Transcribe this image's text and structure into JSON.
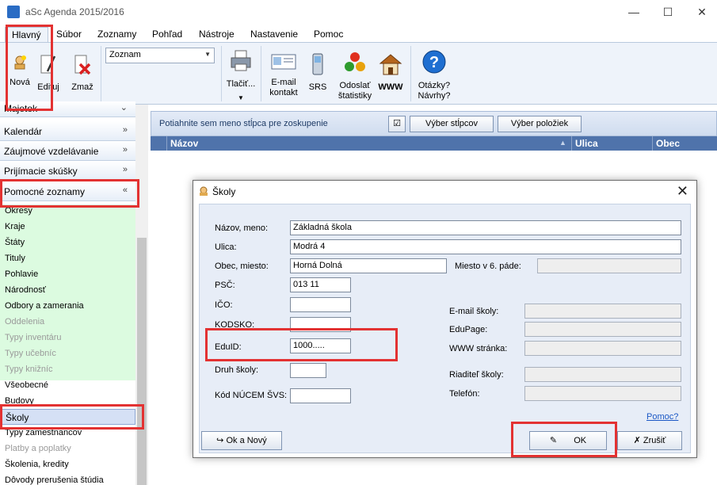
{
  "window": {
    "title": "aSc Agenda 2015/2016",
    "controls": {
      "minimize": "—",
      "maximize": "☐",
      "close": "✕"
    }
  },
  "ribbon_tabs": [
    "Hlavný",
    "Súbor",
    "Zoznamy",
    "Pohľad",
    "Nástroje",
    "Nastavenie",
    "Pomoc"
  ],
  "ribbon": {
    "nova": "Nová",
    "edituj": "Edituj",
    "zmaz": "Zmaž",
    "combo_value": "Zoznam",
    "tlacit": "Tlačiť...",
    "email_kontakt": [
      "E-mail",
      "kontakt"
    ],
    "srs": "SRS",
    "odoslat": [
      "Odoslať",
      "štatistiky"
    ],
    "www": "WWW",
    "otazky": [
      "Otázky?",
      "Návrhy?"
    ]
  },
  "sidebar": {
    "top_partial": "Majetok",
    "sections": [
      "Kalendár",
      "Záujmové vzdelávanie",
      "Prijímacie skúšky",
      "Pomocné zoznamy"
    ],
    "items": [
      {
        "label": "Okresy",
        "disabled": false
      },
      {
        "label": "Kraje",
        "disabled": false
      },
      {
        "label": "Štáty",
        "disabled": false
      },
      {
        "label": "Tituly",
        "disabled": false
      },
      {
        "label": "Pohlavie",
        "disabled": false
      },
      {
        "label": "Národnosť",
        "disabled": false
      },
      {
        "label": "Odbory a zamerania",
        "disabled": false
      },
      {
        "label": "Oddelenia",
        "disabled": true
      },
      {
        "label": "Typy inventáru",
        "disabled": true
      },
      {
        "label": "Typy učebníc",
        "disabled": true
      },
      {
        "label": "Typy knižníc",
        "disabled": true
      },
      {
        "label": "Všeobecné",
        "disabled": false
      },
      {
        "label": "Budovy",
        "disabled": false
      },
      {
        "label": "Školy",
        "disabled": false
      },
      {
        "label": "Typy zamestnancov",
        "disabled": false
      },
      {
        "label": "Platby a poplatky",
        "disabled": true
      },
      {
        "label": "Školenia, kredity",
        "disabled": false
      },
      {
        "label": "Dôvody prerušenia štúdia",
        "disabled": false
      }
    ]
  },
  "grid": {
    "group_hint": "Potiahnite sem meno stĺpca pre zoskupenie",
    "btn_columns": "Výber stĺpcov",
    "btn_items": "Výber položiek",
    "columns": [
      "Názov",
      "Ulica",
      "Obec"
    ]
  },
  "dialog": {
    "title": "Školy",
    "labels": {
      "nazov": "Názov, meno:",
      "ulica": "Ulica:",
      "obec": "Obec, miesto:",
      "miesto6": "Miesto v 6. páde:",
      "psc": "PSČ:",
      "ico": "IČO:",
      "kodsko": "KODSKO:",
      "eduid": "EduID:",
      "druh": "Druh školy:",
      "kod_nucem": "Kód NÚCEM ŠVS:",
      "email": "E-mail školy:",
      "edupage": "EduPage:",
      "www": "WWW stránka:",
      "riaditel": "Riaditeľ školy:",
      "telefon": "Telefón:"
    },
    "values": {
      "nazov": "Základná škola",
      "ulica": "Modrá 4",
      "obec": "Horná Dolná",
      "psc": "013 11",
      "eduid": "1000....."
    },
    "help_link": "Pomoc?",
    "btn_ok_new": "Ok a Nový",
    "btn_ok": "OK",
    "btn_cancel": "Zrušiť"
  },
  "colors": {
    "highlight": "#e33232",
    "list_bg": "#dcfbe0",
    "column_header": "#4f73ab"
  }
}
